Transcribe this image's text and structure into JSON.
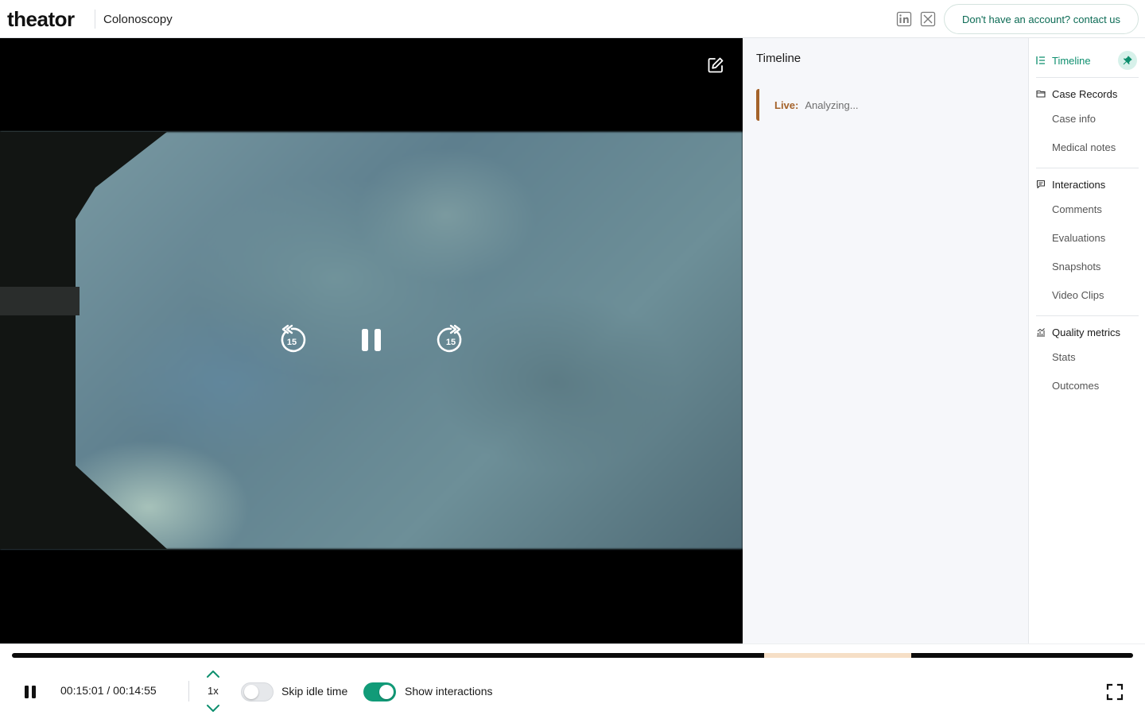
{
  "header": {
    "logo_text": "theator",
    "page_title": "Colonoscopy",
    "contact_label": "Don't have an account? contact us",
    "social_icons": [
      "linkedin-icon",
      "x-twitter-icon"
    ]
  },
  "video": {
    "rewind_seconds": "15",
    "forward_seconds": "15",
    "icons": [
      "edit-icon",
      "rewind-15-icon",
      "pause-icon",
      "forward-15-icon"
    ]
  },
  "timeline": {
    "title": "Timeline",
    "live_label": "Live:",
    "live_text": "Analyzing..."
  },
  "nav": {
    "sections": [
      {
        "label": "Timeline",
        "icon": "list-icon",
        "active": true,
        "items": []
      },
      {
        "label": "Case Records",
        "icon": "folder-icon",
        "items": [
          "Case info",
          "Medical notes"
        ]
      },
      {
        "label": "Interactions",
        "icon": "chat-icon",
        "items": [
          "Comments",
          "Evaluations",
          "Snapshots",
          "Video Clips"
        ]
      },
      {
        "label": "Quality metrics",
        "icon": "chart-icon",
        "items": [
          "Stats",
          "Outcomes"
        ]
      }
    ],
    "pin_icon": "pin-icon"
  },
  "player": {
    "time_display": "00:15:01 / 00:14:55",
    "speed": "1x",
    "skip_idle_label": "Skip idle time",
    "skip_idle_on": false,
    "show_interactions_label": "Show interactions",
    "show_interactions_on": true,
    "highlight_range_fraction": [
      0.671,
      0.802
    ]
  },
  "colors": {
    "accent_green": "#119b78",
    "live_brown": "#a4622a",
    "progress_highlight": "#f6dfc6"
  }
}
